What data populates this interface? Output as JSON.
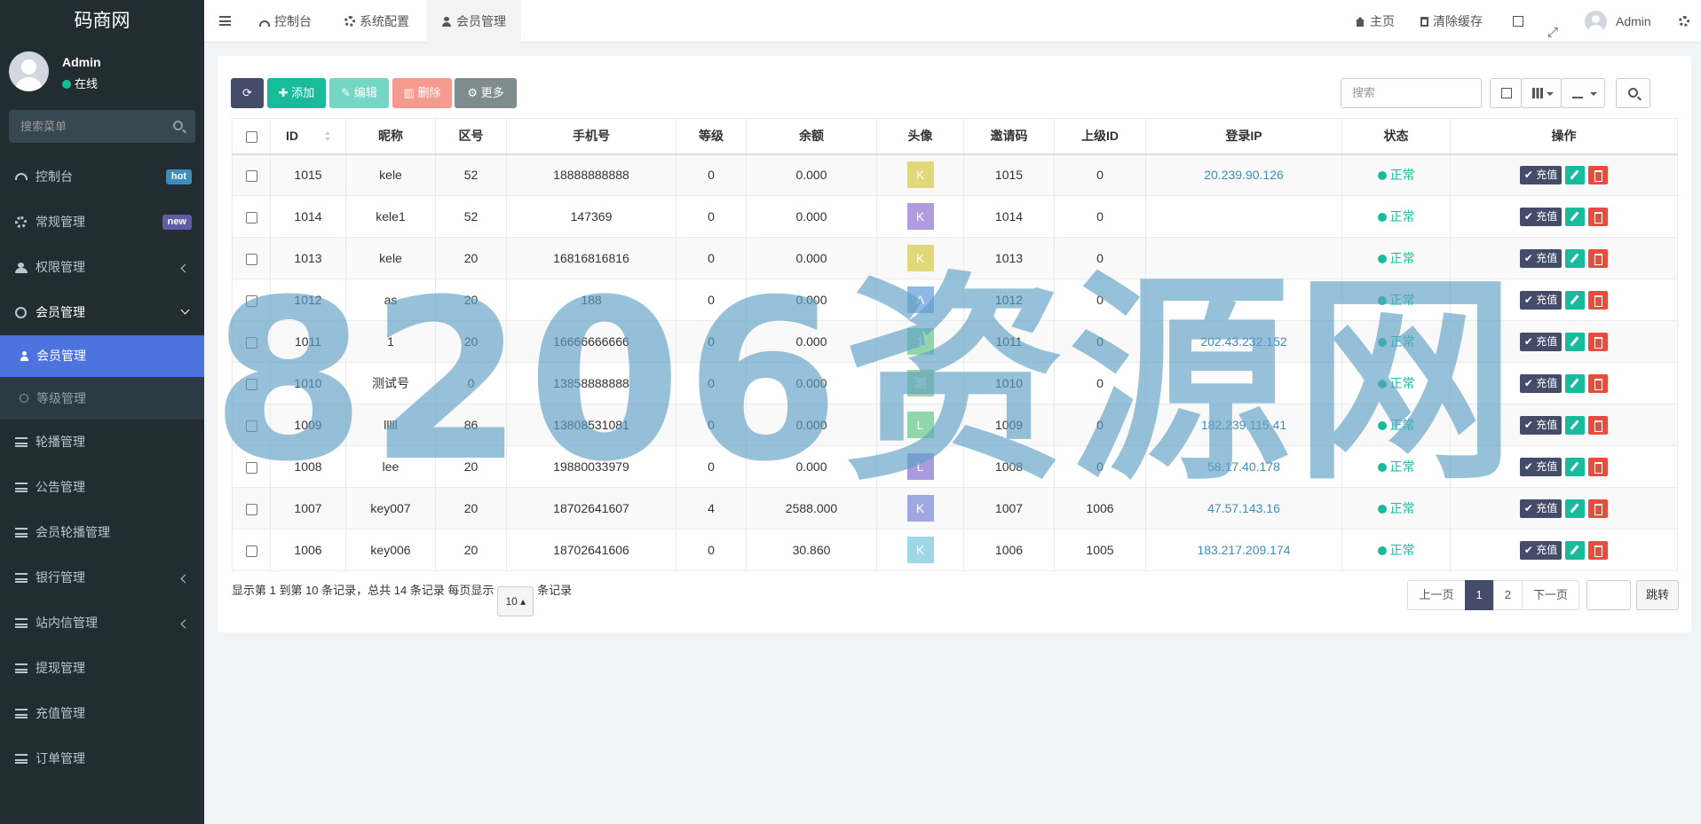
{
  "app": {
    "logo": "码商网"
  },
  "user": {
    "name": "Admin",
    "status": "在线"
  },
  "sidebar": {
    "search_placeholder": "搜索菜单",
    "items": [
      {
        "label": "控制台",
        "badge": "hot"
      },
      {
        "label": "常规管理",
        "badge": "new"
      },
      {
        "label": "权限管理"
      },
      {
        "label": "会员管理"
      },
      {
        "label": "轮播管理"
      },
      {
        "label": "公告管理"
      },
      {
        "label": "会员轮播管理"
      },
      {
        "label": "银行管理"
      },
      {
        "label": "站内信管理"
      },
      {
        "label": "提现管理"
      },
      {
        "label": "充值管理"
      },
      {
        "label": "订单管理"
      }
    ],
    "submenu": [
      {
        "label": "会员管理"
      },
      {
        "label": "等级管理"
      }
    ]
  },
  "topbar": {
    "tabs": [
      "控制台",
      "系统配置",
      "会员管理"
    ],
    "home": "主页",
    "clear_cache": "清除缓存",
    "admin": "Admin"
  },
  "toolbar": {
    "add": "添加",
    "edit": "编辑",
    "delete": "删除",
    "more": "更多",
    "search_placeholder": "搜索"
  },
  "table": {
    "headers": [
      "ID",
      "昵称",
      "区号",
      "手机号",
      "等级",
      "余额",
      "头像",
      "邀请码",
      "上级ID",
      "登录IP",
      "状态",
      "操作"
    ],
    "rows": [
      {
        "id": "1015",
        "nick": "kele",
        "area": "52",
        "phone": "18888888888",
        "level": "0",
        "balance": "0.000",
        "avatar": "K",
        "avatar_color": "#e0d87a",
        "invite": "1015",
        "parent": "0",
        "ip": "20.239.90.126",
        "status": "正常"
      },
      {
        "id": "1014",
        "nick": "kele1",
        "area": "52",
        "phone": "147369",
        "level": "0",
        "balance": "0.000",
        "avatar": "K",
        "avatar_color": "#b19be0",
        "invite": "1014",
        "parent": "0",
        "ip": "",
        "status": "正常"
      },
      {
        "id": "1013",
        "nick": "kele",
        "area": "20",
        "phone": "16816816816",
        "level": "0",
        "balance": "0.000",
        "avatar": "K",
        "avatar_color": "#e0d87a",
        "invite": "1013",
        "parent": "0",
        "ip": "",
        "status": "正常"
      },
      {
        "id": "1012",
        "nick": "as",
        "area": "20",
        "phone": "188",
        "level": "0",
        "balance": "0.000",
        "avatar": "A",
        "avatar_color": "#8fb8e6",
        "invite": "1012",
        "parent": "0",
        "ip": "",
        "status": "正常"
      },
      {
        "id": "1011",
        "nick": "1",
        "area": "20",
        "phone": "16666666666",
        "level": "0",
        "balance": "0.000",
        "avatar": "1",
        "avatar_color": "#8fd6a8",
        "invite": "1011",
        "parent": "0",
        "ip": "202.43.232.152",
        "status": "正常"
      },
      {
        "id": "1010",
        "nick": "测试号",
        "area": "0",
        "phone": "13858888888",
        "level": "0",
        "balance": "0.000",
        "avatar": "测",
        "avatar_color": "#9ed6a0",
        "invite": "1010",
        "parent": "0",
        "ip": "",
        "status": "正常"
      },
      {
        "id": "1009",
        "nick": "lllll",
        "area": "86",
        "phone": "13808531081",
        "level": "0",
        "balance": "0.000",
        "avatar": "L",
        "avatar_color": "#8fd6a8",
        "invite": "1009",
        "parent": "0",
        "ip": "182.239.115.41",
        "status": "正常"
      },
      {
        "id": "1008",
        "nick": "lee",
        "area": "20",
        "phone": "19880033979",
        "level": "0",
        "balance": "0.000",
        "avatar": "L",
        "avatar_color": "#a89be0",
        "invite": "1008",
        "parent": "0",
        "ip": "58.17.40.178",
        "status": "正常"
      },
      {
        "id": "1007",
        "nick": "key007",
        "area": "20",
        "phone": "18702641607",
        "level": "4",
        "balance": "2588.000",
        "avatar": "K",
        "avatar_color": "#9fa8e0",
        "invite": "1007",
        "parent": "1006",
        "ip": "47.57.143.16",
        "status": "正常"
      },
      {
        "id": "1006",
        "nick": "key006",
        "area": "20",
        "phone": "18702641606",
        "level": "0",
        "balance": "30.860",
        "avatar": "K",
        "avatar_color": "#9ed8e6",
        "invite": "1006",
        "parent": "1005",
        "ip": "183.217.209.174",
        "status": "正常"
      }
    ],
    "op_charge": "充值"
  },
  "pagination": {
    "info_prefix": "显示第 1 到第 10 条记录，总共 14 条记录 每页显示",
    "page_size": "10",
    "info_suffix": "条记录",
    "prev": "上一页",
    "pages": [
      "1",
      "2"
    ],
    "next": "下一页",
    "go": "跳转"
  },
  "watermark": "8206资源网"
}
